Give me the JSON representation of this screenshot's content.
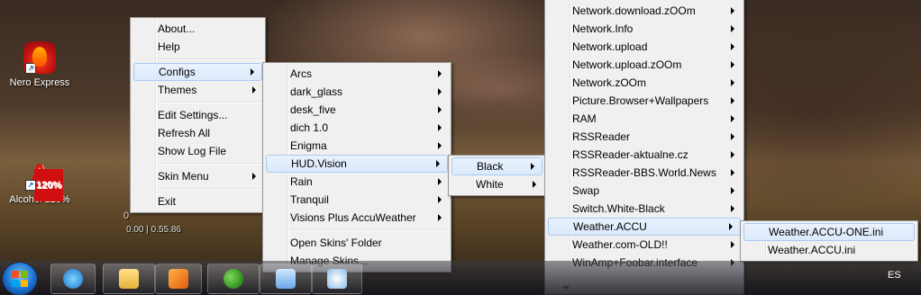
{
  "desktop_icons": [
    {
      "label": "Nero Express",
      "icon": "nero-flame-icon"
    },
    {
      "label": "Alcohol 120%",
      "icon": "alcohol-120-icon"
    }
  ],
  "meter": {
    "value": "0",
    "readout": "0.00 | 0.55.86"
  },
  "main_menu": {
    "items": [
      {
        "label": "About...",
        "submenu": false
      },
      {
        "label": "Help",
        "submenu": false
      },
      {
        "label": "Configs",
        "submenu": true,
        "highlighted": true
      },
      {
        "label": "Themes",
        "submenu": true
      },
      {
        "label": "Edit Settings...",
        "submenu": false
      },
      {
        "label": "Refresh All",
        "submenu": false
      },
      {
        "label": "Show Log File",
        "submenu": false
      },
      {
        "label": "Skin Menu",
        "submenu": true
      },
      {
        "label": "Exit",
        "submenu": false
      }
    ]
  },
  "configs_menu": {
    "items": [
      {
        "label": "Arcs"
      },
      {
        "label": "dark_glass"
      },
      {
        "label": "desk_five"
      },
      {
        "label": "dich 1.0"
      },
      {
        "label": "Enigma"
      },
      {
        "label": "HUD.Vision",
        "highlighted": true
      },
      {
        "label": "Rain"
      },
      {
        "label": "Tranquil"
      },
      {
        "label": "Visions Plus AccuWeather"
      }
    ],
    "actions": [
      "Open Skins' Folder",
      "Manage Skins..."
    ]
  },
  "hud_menu": {
    "items": [
      "Black",
      "White"
    ],
    "highlighted": "Black"
  },
  "skins_list": {
    "items": [
      "Network.download.zOOm",
      "Network.Info",
      "Network.upload",
      "Network.upload.zOOm",
      "Network.zOOm",
      "Picture.Browser+Wallpapers",
      "RAM",
      "RSSReader",
      "RSSReader-aktualne.cz",
      "RSSReader-BBS.World.News",
      "Swap",
      "Switch.White-Black",
      "Weather.ACCU",
      "Weather.com-OLD!!",
      "WinAmp+Foobar.interface"
    ],
    "highlighted": "Weather.ACCU"
  },
  "weather_menu": {
    "items": [
      "Weather.ACCU-ONE.ini",
      "Weather.ACCU.ini"
    ],
    "highlighted": "Weather.ACCU-ONE.ini"
  },
  "taskbar": {
    "language": "ES",
    "buttons": [
      "internet-explorer-icon",
      "file-explorer-icon",
      "media-player-icon",
      "messenger-icon",
      "window-icon",
      "window-icon-2"
    ]
  }
}
